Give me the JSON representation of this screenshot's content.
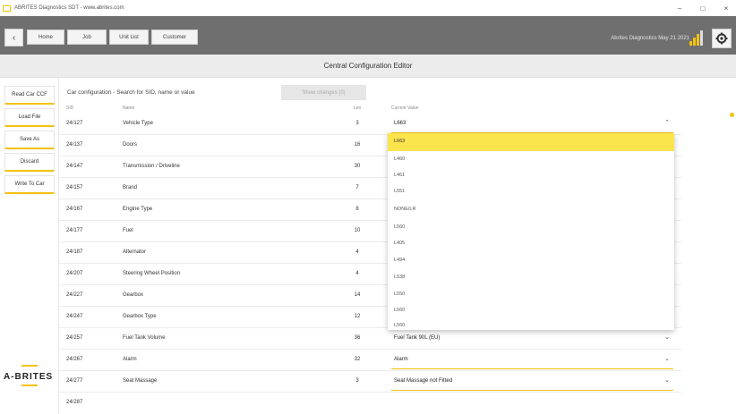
{
  "window": {
    "title": "ABRITES Diagnostics SDT - www.abrites.com",
    "controls": [
      "–",
      "□",
      "×"
    ]
  },
  "toolbar": {
    "back_icon": "‹",
    "home": "Home",
    "job": "Job",
    "unit": "Unit List",
    "customer": "Customer",
    "status": "Abrites Diagnostics May 21 2021",
    "signal_icon": "signal-bars-icon",
    "settings_icon": "gear-icon",
    "accent": "#f4c20d"
  },
  "page": {
    "title": "Central Configuration Editor"
  },
  "left_panel": {
    "buttons": [
      "Read Car CCF",
      "Load File",
      "Save As",
      "Discard",
      "Write To Car"
    ],
    "logo": "A-BRITES"
  },
  "main": {
    "config_label": "Car configuration - Search for SID, name or value",
    "show_changes": "Show changes (0)",
    "columns": {
      "sid": "SID",
      "name": "Name",
      "len": "Len",
      "value": "Current Value"
    },
    "rows": [
      {
        "sid": "24/127",
        "name": "Vehicle Type",
        "len": "3",
        "value": "L663"
      },
      {
        "sid": "24/137",
        "name": "Doors",
        "len": "16",
        "value": ""
      },
      {
        "sid": "24/147",
        "name": "Transmission / Driveline",
        "len": "30",
        "value": ""
      },
      {
        "sid": "24/157",
        "name": "Brand",
        "len": "7",
        "value": ""
      },
      {
        "sid": "24/167",
        "name": "Engine Type",
        "len": "8",
        "value": ""
      },
      {
        "sid": "24/177",
        "name": "Fuel",
        "len": "10",
        "value": ""
      },
      {
        "sid": "24/187",
        "name": "Alternator",
        "len": "4",
        "value": ""
      },
      {
        "sid": "24/207",
        "name": "Steering Wheel Position",
        "len": "4",
        "value": ""
      },
      {
        "sid": "24/227",
        "name": "Gearbox",
        "len": "14",
        "value": ""
      },
      {
        "sid": "24/247",
        "name": "Gearbox Type",
        "len": "12",
        "value": ""
      },
      {
        "sid": "24/257",
        "name": "Fuel Tank Volume",
        "len": "36",
        "value": "Fuel Tank 90L (EU)"
      },
      {
        "sid": "24/267",
        "name": "Alarm",
        "len": "32",
        "value": "Alarm"
      },
      {
        "sid": "24/277",
        "name": "Seat Massage",
        "len": "3",
        "value": "Seat Massage not Fitted"
      },
      {
        "sid": "24/287",
        "name": "",
        "len": "",
        "value": ""
      }
    ]
  },
  "dropdown": {
    "selected": "L663",
    "options": [
      "L663",
      "L460",
      "L461",
      "L551",
      "NONE/LR",
      "L560",
      "L405",
      "L494",
      "L538",
      "L550",
      "L560",
      "L560"
    ]
  }
}
